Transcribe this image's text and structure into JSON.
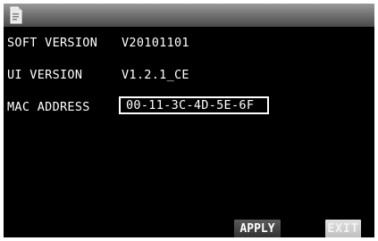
{
  "header": {
    "icon": "document-icon"
  },
  "info": {
    "soft_version_label": "SOFT VERSION",
    "soft_version_value": "V20101101",
    "ui_version_label": "UI VERSION",
    "ui_version_value": "V1.2.1_CE",
    "mac_address_label": "MAC ADDRESS",
    "mac_address_value": "00-11-3C-4D-5E-6F"
  },
  "buttons": {
    "apply_label": "APPLY",
    "exit_label": "EXIT"
  },
  "colors": {
    "background": "#000000",
    "text": "#ffffff",
    "title_bar": "#6c6c6c"
  }
}
